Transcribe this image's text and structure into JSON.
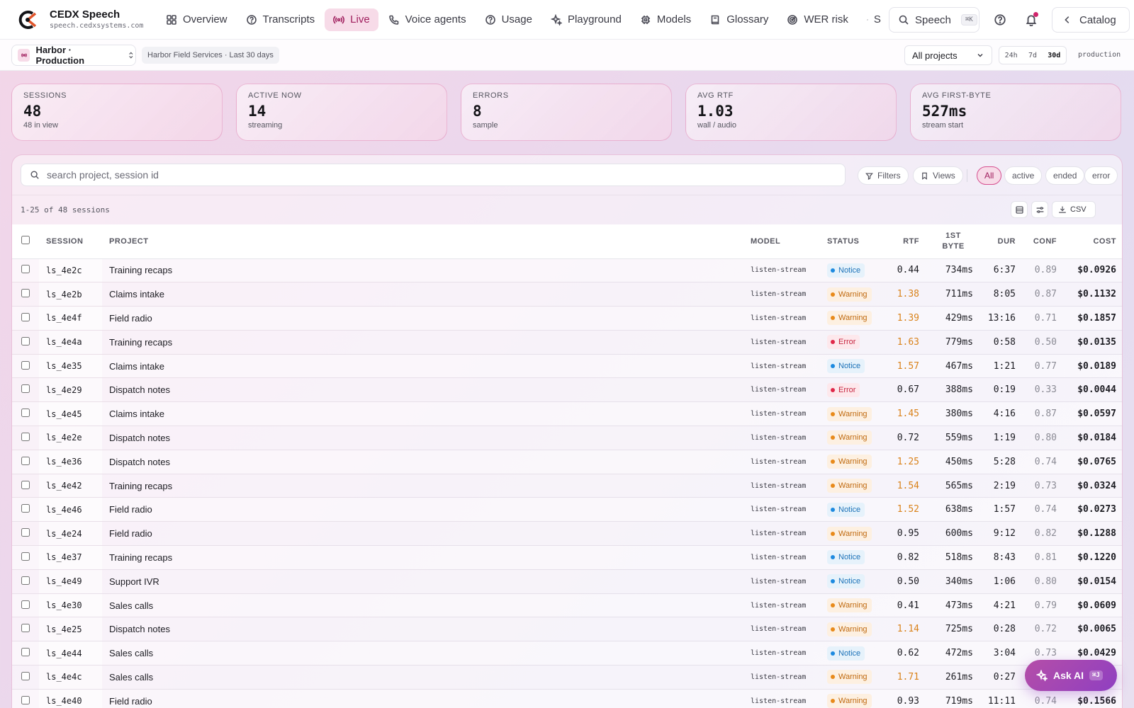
{
  "app": {
    "name": "CEDX Speech",
    "url": "speech.cedxsystems.com"
  },
  "nav": [
    {
      "label": "Overview",
      "icon": "grid-icon"
    },
    {
      "label": "Transcripts",
      "icon": "help-circle-icon"
    },
    {
      "label": "Live",
      "icon": "broadcast-icon",
      "active": true
    },
    {
      "label": "Voice agents",
      "icon": "phone-icon"
    },
    {
      "label": "Usage",
      "icon": "help-circle-icon"
    },
    {
      "label": "Playground",
      "icon": "sparkle-icon"
    },
    {
      "label": "Models",
      "icon": "chip-icon"
    },
    {
      "label": "Glossary",
      "icon": "book-icon"
    },
    {
      "label": "WER risk",
      "icon": "radar-icon"
    },
    {
      "label": "S",
      "icon": "sliders-icon"
    }
  ],
  "header": {
    "search_label": "Speech",
    "search_kbd": "⌘K",
    "catalog_label": "Catalog"
  },
  "subbar": {
    "project": "Harbor · Production",
    "context": "Harbor Field Services · Last 30 days",
    "projects_filter": "All projects",
    "ranges": [
      "24h",
      "7d",
      "30d"
    ],
    "selected_range": "30d",
    "environment": "production"
  },
  "stats": [
    {
      "label": "SESSIONS",
      "value": "48",
      "sub": "48 in view"
    },
    {
      "label": "ACTIVE NOW",
      "value": "14",
      "sub": "streaming"
    },
    {
      "label": "ERRORS",
      "value": "8",
      "sub": "sample"
    },
    {
      "label": "AVG RTF",
      "value": "1.03",
      "sub": "wall / audio"
    },
    {
      "label": "AVG FIRST-BYTE",
      "value": "527ms",
      "sub": "stream start"
    }
  ],
  "toolbar": {
    "search_placeholder": "search project, session id",
    "filters_label": "Filters",
    "views_label": "Views",
    "status_filters": [
      "All",
      "active",
      "ended",
      "error"
    ],
    "active_status_filter": "All",
    "range_text": "1-25 of 48 sessions",
    "csv_label": "CSV"
  },
  "table": {
    "columns": [
      "SESSION",
      "PROJECT",
      "MODEL",
      "STATUS",
      "RTF",
      "1ST BYTE",
      "DUR",
      "CONF",
      "COST"
    ],
    "rows": [
      {
        "session": "ls_4e2c",
        "project": "Training recaps",
        "model": "listen-stream",
        "status": "Notice",
        "rtf": "0.44",
        "first_byte": "734ms",
        "dur": "6:37",
        "conf": "0.89",
        "cost": "$0.0926"
      },
      {
        "session": "ls_4e2b",
        "project": "Claims intake",
        "model": "listen-stream",
        "status": "Warning",
        "rtf": "1.38",
        "first_byte": "711ms",
        "dur": "8:05",
        "conf": "0.87",
        "cost": "$0.1132"
      },
      {
        "session": "ls_4e4f",
        "project": "Field radio",
        "model": "listen-stream",
        "status": "Warning",
        "rtf": "1.39",
        "first_byte": "429ms",
        "dur": "13:16",
        "conf": "0.71",
        "cost": "$0.1857"
      },
      {
        "session": "ls_4e4a",
        "project": "Training recaps",
        "model": "listen-stream",
        "status": "Error",
        "rtf": "1.63",
        "first_byte": "779ms",
        "dur": "0:58",
        "conf": "0.50",
        "cost": "$0.0135"
      },
      {
        "session": "ls_4e35",
        "project": "Claims intake",
        "model": "listen-stream",
        "status": "Notice",
        "rtf": "1.57",
        "first_byte": "467ms",
        "dur": "1:21",
        "conf": "0.77",
        "cost": "$0.0189"
      },
      {
        "session": "ls_4e29",
        "project": "Dispatch notes",
        "model": "listen-stream",
        "status": "Error",
        "rtf": "0.67",
        "first_byte": "388ms",
        "dur": "0:19",
        "conf": "0.33",
        "cost": "$0.0044"
      },
      {
        "session": "ls_4e45",
        "project": "Claims intake",
        "model": "listen-stream",
        "status": "Warning",
        "rtf": "1.45",
        "first_byte": "380ms",
        "dur": "4:16",
        "conf": "0.87",
        "cost": "$0.0597"
      },
      {
        "session": "ls_4e2e",
        "project": "Dispatch notes",
        "model": "listen-stream",
        "status": "Warning",
        "rtf": "0.72",
        "first_byte": "559ms",
        "dur": "1:19",
        "conf": "0.80",
        "cost": "$0.0184"
      },
      {
        "session": "ls_4e36",
        "project": "Dispatch notes",
        "model": "listen-stream",
        "status": "Warning",
        "rtf": "1.25",
        "first_byte": "450ms",
        "dur": "5:28",
        "conf": "0.74",
        "cost": "$0.0765"
      },
      {
        "session": "ls_4e42",
        "project": "Training recaps",
        "model": "listen-stream",
        "status": "Warning",
        "rtf": "1.54",
        "first_byte": "565ms",
        "dur": "2:19",
        "conf": "0.73",
        "cost": "$0.0324"
      },
      {
        "session": "ls_4e46",
        "project": "Field radio",
        "model": "listen-stream",
        "status": "Notice",
        "rtf": "1.52",
        "first_byte": "638ms",
        "dur": "1:57",
        "conf": "0.74",
        "cost": "$0.0273"
      },
      {
        "session": "ls_4e24",
        "project": "Field radio",
        "model": "listen-stream",
        "status": "Warning",
        "rtf": "0.95",
        "first_byte": "600ms",
        "dur": "9:12",
        "conf": "0.82",
        "cost": "$0.1288"
      },
      {
        "session": "ls_4e37",
        "project": "Training recaps",
        "model": "listen-stream",
        "status": "Notice",
        "rtf": "0.82",
        "first_byte": "518ms",
        "dur": "8:43",
        "conf": "0.81",
        "cost": "$0.1220"
      },
      {
        "session": "ls_4e49",
        "project": "Support IVR",
        "model": "listen-stream",
        "status": "Notice",
        "rtf": "0.50",
        "first_byte": "340ms",
        "dur": "1:06",
        "conf": "0.80",
        "cost": "$0.0154"
      },
      {
        "session": "ls_4e30",
        "project": "Sales calls",
        "model": "listen-stream",
        "status": "Warning",
        "rtf": "0.41",
        "first_byte": "473ms",
        "dur": "4:21",
        "conf": "0.79",
        "cost": "$0.0609"
      },
      {
        "session": "ls_4e25",
        "project": "Dispatch notes",
        "model": "listen-stream",
        "status": "Warning",
        "rtf": "1.14",
        "first_byte": "725ms",
        "dur": "0:28",
        "conf": "0.72",
        "cost": "$0.0065"
      },
      {
        "session": "ls_4e44",
        "project": "Sales calls",
        "model": "listen-stream",
        "status": "Notice",
        "rtf": "0.62",
        "first_byte": "472ms",
        "dur": "3:04",
        "conf": "0.73",
        "cost": "$0.0429"
      },
      {
        "session": "ls_4e4c",
        "project": "Sales calls",
        "model": "listen-stream",
        "status": "Warning",
        "rtf": "1.71",
        "first_byte": "261ms",
        "dur": "0:27",
        "conf": "",
        "cost": ""
      },
      {
        "session": "ls_4e40",
        "project": "Field radio",
        "model": "listen-stream",
        "status": "Warning",
        "rtf": "0.93",
        "first_byte": "719ms",
        "dur": "11:11",
        "conf": "0.74",
        "cost": "$0.1566"
      }
    ]
  },
  "ask_ai": {
    "label": "Ask AI",
    "kbd": "⌘J"
  },
  "colors": {
    "accent": "#a01f5e",
    "rtf_hot": "#d9821a",
    "notice": "#1d8ae0",
    "warning": "#e88a1a",
    "error": "#e0284a"
  }
}
